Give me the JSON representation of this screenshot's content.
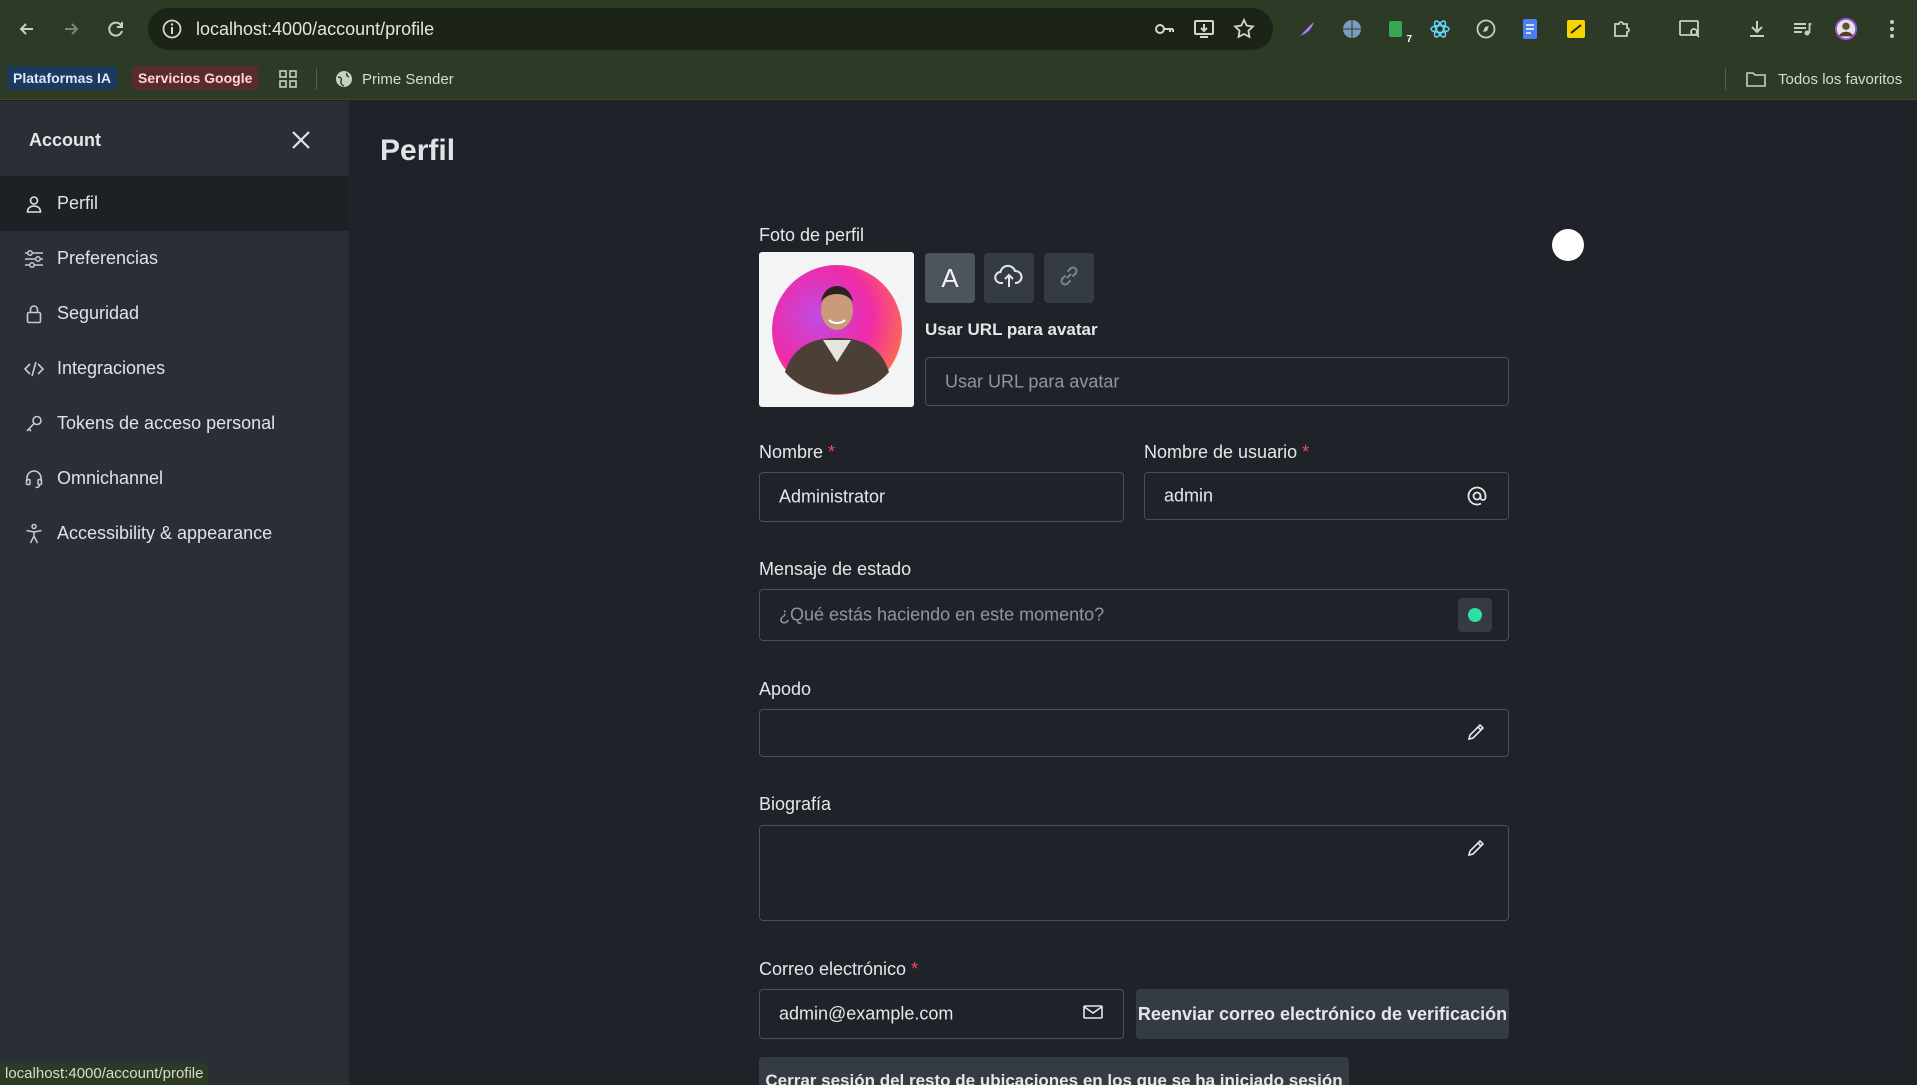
{
  "browser": {
    "url": "localhost:4000/account/profile",
    "extension_badge": "7",
    "bookmarks": [
      {
        "label": "Plataformas IA",
        "bg": "#1c3a5c",
        "color": "#d9e6ff"
      },
      {
        "label": "Servicios Google",
        "bg": "#5a2b2b",
        "color": "#ffd6d6"
      }
    ],
    "bookmark_link": "Prime Sender",
    "all_bookmarks": "Todos los favoritos",
    "status_url": "localhost:4000/account/profile"
  },
  "sidebar": {
    "title": "Account",
    "items": [
      {
        "label": "Perfil",
        "icon": "user-icon",
        "active": true
      },
      {
        "label": "Preferencias",
        "icon": "sliders-icon",
        "active": false
      },
      {
        "label": "Seguridad",
        "icon": "lock-icon",
        "active": false
      },
      {
        "label": "Integraciones",
        "icon": "code-icon",
        "active": false
      },
      {
        "label": "Tokens de acceso personal",
        "icon": "key-icon",
        "active": false
      },
      {
        "label": "Omnichannel",
        "icon": "headset-icon",
        "active": false
      },
      {
        "label": "Accessibility & appearance",
        "icon": "accessibility-icon",
        "active": false
      }
    ]
  },
  "main": {
    "title": "Perfil",
    "avatar": {
      "label": "Foto de perfil",
      "letter_button": "A",
      "url_label": "Usar URL para avatar",
      "url_placeholder": "Usar URL para avatar"
    },
    "name": {
      "label": "Nombre",
      "required": "*",
      "value": "Administrator"
    },
    "username": {
      "label": "Nombre de usuario",
      "required": "*",
      "value": "admin"
    },
    "status": {
      "label": "Mensaje de estado",
      "placeholder": "¿Qué estás haciendo en este momento?",
      "dot_color": "#2de0a5"
    },
    "nickname": {
      "label": "Apodo",
      "value": ""
    },
    "bio": {
      "label": "Biografía",
      "value": ""
    },
    "email": {
      "label": "Correo electrónico",
      "required": "*",
      "value": "admin@example.com"
    },
    "resend_button": "Reenviar correo electrónico de verificación",
    "logout_others_button": "Cerrar sesión del resto de ubicaciones en los que se ha iniciado sesión"
  },
  "colors": {
    "accent_dot": "#2de0a5",
    "required": "#f5455c"
  }
}
